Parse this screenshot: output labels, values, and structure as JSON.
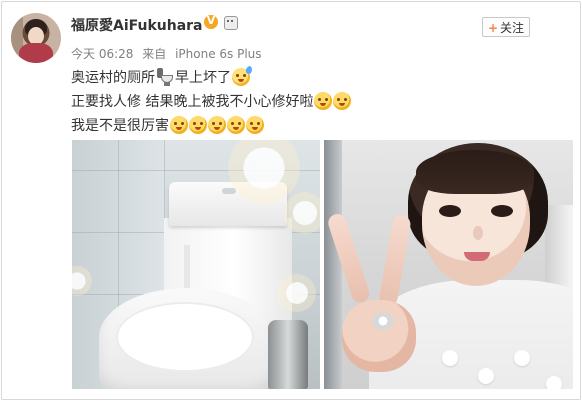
{
  "user": {
    "name": "福原愛AiFukuhara"
  },
  "post": {
    "time": "今天 06:28",
    "source_prefix": "来自",
    "source_device": "iPhone 6s Plus",
    "lines": [
      {
        "text_before": "奥运村的厕所",
        "text_after": "早上坏了"
      },
      {
        "text": "正要找人修 结果晚上被我不小心修好啦"
      },
      {
        "text": "我是不是很厉害"
      }
    ]
  },
  "follow_button": {
    "label": "关注",
    "plus": "+"
  },
  "icons": {
    "verified": "verified-v-badge-icon",
    "robot": "robot-badge-icon",
    "toilet": "toilet-icon",
    "emoji_sweat": "sweat-face-emoji-icon",
    "emoji_grin": "grin-face-emoji-icon",
    "emoji_laugh": "laugh-face-emoji-icon"
  },
  "colors": {
    "accent_orange": "#ff8140",
    "verified_orange": "#f5a623",
    "meta_gray": "#808080"
  }
}
